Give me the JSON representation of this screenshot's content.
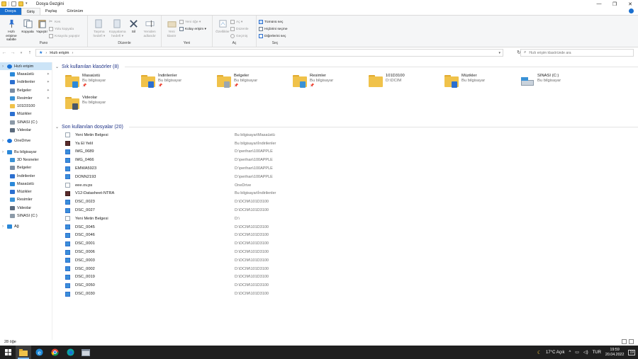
{
  "window": {
    "title": "Dosya Gezgini",
    "controls": [
      "—",
      "❐",
      "✕"
    ]
  },
  "ribbon_tabs": [
    {
      "label": "Dosya",
      "kind": "file"
    },
    {
      "label": "Giriş",
      "kind": "active"
    },
    {
      "label": "Paylaş",
      "kind": ""
    },
    {
      "label": "Görünüm",
      "kind": ""
    }
  ],
  "ribbon": {
    "pano": {
      "label": "Pano",
      "pin": "Hızlı erişime sabitle",
      "copy": "Kopyala",
      "paste": "Yapıştır",
      "cut": "Kes",
      "copy_path": "Yolu kopyala",
      "paste_shortcut": "Kısayolu yapıştır"
    },
    "duzenle": {
      "label": "Düzenle",
      "move_to": "Taşıma hedefi ▾",
      "copy_to": "Kopyalama hedefi ▾",
      "delete": "Sil",
      "rename": "Yeniden adlandır"
    },
    "yeni": {
      "label": "Yeni",
      "new_folder": "Yeni klasör",
      "new_item": "Yeni öğe ▾",
      "easy_access": "Kolay erişim ▾"
    },
    "ac": {
      "label": "Aç",
      "properties": "Özellikler",
      "open": "Aç ▾",
      "edit": "Düzenle",
      "history": "Geçmiş"
    },
    "sec": {
      "label": "Seç",
      "select_all": "Tümünü seç",
      "select_none": "Hiçbirini seçme",
      "invert": "Diğerlerini seç"
    }
  },
  "address": {
    "crumb": "Hızlı erişim",
    "search_placeholder": "Hızlı erişim klasöründe ara"
  },
  "nav": [
    {
      "label": "Hızlı erişim",
      "level": 0,
      "icon": "star-icon",
      "color": "#1a73d9",
      "pin": false,
      "sel": true
    },
    {
      "label": "Masaüstü",
      "level": 1,
      "icon": "desktop-icon",
      "color": "#2b88d8",
      "pin": true
    },
    {
      "label": "İndirilenler",
      "level": 1,
      "icon": "download-icon",
      "color": "#2b6fd0",
      "pin": true
    },
    {
      "label": "Belgeler",
      "level": 1,
      "icon": "documents-icon",
      "color": "#7a8da3",
      "pin": true
    },
    {
      "label": "Resimler",
      "level": 1,
      "icon": "pictures-icon",
      "color": "#3a92d6",
      "pin": true
    },
    {
      "label": "101D3100",
      "level": 1,
      "icon": "folder-icon",
      "color": "#f0c24a",
      "pin": false
    },
    {
      "label": "Müzikler",
      "level": 1,
      "icon": "music-icon",
      "color": "#2b6fd0",
      "pin": false
    },
    {
      "label": "SINASI (C:)",
      "level": 1,
      "icon": "drive-icon",
      "color": "#8c9aa8",
      "pin": false
    },
    {
      "label": "Videolar",
      "level": 1,
      "icon": "videos-icon",
      "color": "#5b6b7d",
      "pin": false
    },
    {
      "label": "",
      "level": -1
    },
    {
      "label": "OneDrive",
      "level": 0,
      "icon": "cloud-icon",
      "color": "#1a73d9",
      "pin": false
    },
    {
      "label": "",
      "level": -1
    },
    {
      "label": "Bu bilgisayar",
      "level": 0,
      "icon": "computer-icon",
      "color": "#2b88d8",
      "pin": false
    },
    {
      "label": "3D Nesneler",
      "level": 1,
      "icon": "3d-objects-icon",
      "color": "#3a92d6",
      "pin": false
    },
    {
      "label": "Belgeler",
      "level": 1,
      "icon": "documents-icon",
      "color": "#7a8da3",
      "pin": false
    },
    {
      "label": "İndirilenler",
      "level": 1,
      "icon": "download-icon",
      "color": "#2b6fd0",
      "pin": false
    },
    {
      "label": "Masaüstü",
      "level": 1,
      "icon": "desktop-icon",
      "color": "#2b88d8",
      "pin": false
    },
    {
      "label": "Müzikler",
      "level": 1,
      "icon": "music-icon",
      "color": "#2b6fd0",
      "pin": false
    },
    {
      "label": "Resimler",
      "level": 1,
      "icon": "pictures-icon",
      "color": "#3a92d6",
      "pin": false
    },
    {
      "label": "Videolar",
      "level": 1,
      "icon": "videos-icon",
      "color": "#5b6b7d",
      "pin": false
    },
    {
      "label": "SINASI (C:)",
      "level": 1,
      "icon": "drive-icon",
      "color": "#8c9aa8",
      "pin": false
    },
    {
      "label": "",
      "level": -1
    },
    {
      "label": "Ağ",
      "level": 0,
      "icon": "network-icon",
      "color": "#2b88d8",
      "pin": false
    }
  ],
  "frequent": {
    "header": "Sık kullanılan klasörler (8)",
    "folders": [
      {
        "name": "Masaüstü",
        "sub": "Bu bilgisayar",
        "pinned": true,
        "emblem": "#2b88d8",
        "icon": "desktop-folder-icon"
      },
      {
        "name": "İndirilenler",
        "sub": "Bu bilgisayar",
        "pinned": true,
        "emblem": "#2b6fd0",
        "icon": "downloads-folder-icon"
      },
      {
        "name": "Belgeler",
        "sub": "Bu bilgisayar",
        "pinned": true,
        "emblem": "#9aa6b2",
        "icon": "documents-folder-icon"
      },
      {
        "name": "Resimler",
        "sub": "Bu bilgisayar",
        "pinned": true,
        "emblem": "#3a92d6",
        "icon": "pictures-folder-icon"
      },
      {
        "name": "101D3100",
        "sub": "D:\\DCIM",
        "pinned": false,
        "emblem": "",
        "icon": "folder-icon"
      },
      {
        "name": "Müzikler",
        "sub": "Bu bilgisayar",
        "pinned": false,
        "emblem": "#2b6fd0",
        "icon": "music-folder-icon"
      },
      {
        "name": "SINASI (C:)",
        "sub": "Bu bilgisayar",
        "pinned": false,
        "emblem": "drive",
        "icon": "drive-icon"
      },
      {
        "name": "Videolar",
        "sub": "Bu bilgisayar",
        "pinned": false,
        "emblem": "#4a5868",
        "icon": "videos-folder-icon"
      }
    ],
    "pin_glyph": "📌"
  },
  "recent": {
    "header": "Son kullanılan dosyalar (20)",
    "files": [
      {
        "name": "Yeni Metin Belgesi",
        "loc": "Bu bilgisayar\\Masaüstü",
        "type": "text"
      },
      {
        "name": "Ya El Yelil",
        "loc": "Bu bilgisayar\\İndirilenler",
        "type": "video"
      },
      {
        "name": "IMG_0689",
        "loc": "D:\\perihan\\100APPLE",
        "type": "image"
      },
      {
        "name": "IMG_0466",
        "loc": "D:\\perihan\\100APPLE",
        "type": "image"
      },
      {
        "name": "EMWA5923",
        "loc": "D:\\perihan\\100APPLE",
        "type": "image"
      },
      {
        "name": "DONN2193",
        "loc": "D:\\perihan\\100APPLE",
        "type": "image"
      },
      {
        "name": "eee.ov.ps",
        "loc": "OneDrive",
        "type": "text"
      },
      {
        "name": "V12-Datasheet-NTRA",
        "loc": "Bu bilgisayar\\İndirilenler",
        "type": "video"
      },
      {
        "name": "DSC_0023",
        "loc": "D:\\DCIM\\101D3100",
        "type": "image"
      },
      {
        "name": "DSC_0027",
        "loc": "D:\\DCIM\\101D3100",
        "type": "image"
      },
      {
        "name": "Yeni Metin Belgesi",
        "loc": "D:\\",
        "type": "text"
      },
      {
        "name": "DSC_0045",
        "loc": "D:\\DCIM\\101D3100",
        "type": "image"
      },
      {
        "name": "DSC_0046",
        "loc": "D:\\DCIM\\101D3100",
        "type": "image"
      },
      {
        "name": "DSC_0001",
        "loc": "D:\\DCIM\\101D3100",
        "type": "image"
      },
      {
        "name": "DSC_0006",
        "loc": "D:\\DCIM\\101D3100",
        "type": "image"
      },
      {
        "name": "DSC_0003",
        "loc": "D:\\DCIM\\101D3100",
        "type": "image"
      },
      {
        "name": "DSC_0002",
        "loc": "D:\\DCIM\\101D3100",
        "type": "image"
      },
      {
        "name": "DSC_0019",
        "loc": "D:\\DCIM\\101D3100",
        "type": "image"
      },
      {
        "name": "DSC_0050",
        "loc": "D:\\DCIM\\101D3100",
        "type": "image"
      },
      {
        "name": "DSC_0030",
        "loc": "D:\\DCIM\\101D3100",
        "type": "image"
      }
    ]
  },
  "status": {
    "count": "28 öğe"
  },
  "taskbar": {
    "weather": "17°C  Açık",
    "lang": "TUR",
    "time": "19:59",
    "date": "20.04.2022",
    "notif": "19"
  }
}
